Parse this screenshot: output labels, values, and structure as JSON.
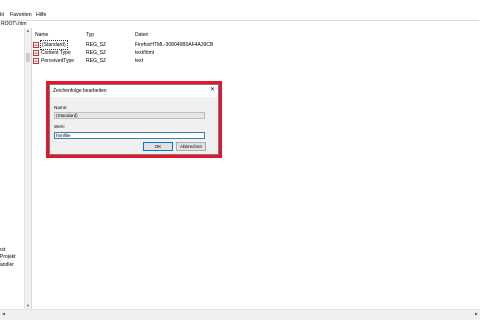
{
  "menu": [
    "kt",
    "Favoriten",
    "Hilfe"
  ],
  "address": "ROOT\\.htm",
  "tree_items": [
    "ıst",
    "Projekt",
    "andler"
  ],
  "columns": {
    "name": "Name",
    "type": "Typ",
    "data": "Daten"
  },
  "rows": [
    {
      "icon": "ab",
      "name": "(Standard)",
      "type": "REG_SZ",
      "data": "FirefoxHTML-308046B0AF4A39CB"
    },
    {
      "icon": "ab",
      "name": "Content Type",
      "type": "REG_SZ",
      "data": "text/html"
    },
    {
      "icon": "ab",
      "name": "PerceivedType",
      "type": "REG_SZ",
      "data": "text"
    }
  ],
  "dialog": {
    "title": "Zeichenfolge bearbeiten",
    "close": "✕",
    "name_label": "Name:",
    "name_value": "(Standard)",
    "value_label": "Wert:",
    "value_value": "htmlfile",
    "ok_label": "OK",
    "cancel_label": "Abbrechen"
  },
  "icons": {
    "string_value": "string-value-icon",
    "close": "close-icon"
  },
  "colors": {
    "highlight_frame": "#e3162b",
    "selected_field_border": "#3c7fb1"
  }
}
